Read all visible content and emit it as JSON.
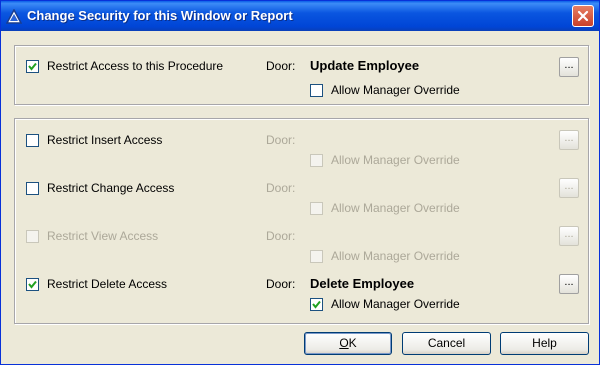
{
  "window": {
    "title": "Change Security for this Window or Report"
  },
  "procedure": {
    "restrict_label": "Restrict Access to this Procedure",
    "restrict_checked": true,
    "door_label": "Door:",
    "door_value": "Update Employee",
    "ellipsis": "...",
    "override_label": "Allow Manager Override",
    "override_checked": false
  },
  "access_rows": [
    {
      "restrict_label": "Restrict Insert Access",
      "restrict_checked": false,
      "restrict_enabled": true,
      "door_label": "Door:",
      "door_value": "",
      "ellipsis": "...",
      "override_label": "Allow Manager Override",
      "override_checked": false,
      "override_enabled": false
    },
    {
      "restrict_label": "Restrict Change Access",
      "restrict_checked": false,
      "restrict_enabled": true,
      "door_label": "Door:",
      "door_value": "",
      "ellipsis": "...",
      "override_label": "Allow Manager Override",
      "override_checked": false,
      "override_enabled": false
    },
    {
      "restrict_label": "Restrict View Access",
      "restrict_checked": false,
      "restrict_enabled": false,
      "door_label": "Door:",
      "door_value": "",
      "ellipsis": "...",
      "override_label": "Allow Manager Override",
      "override_checked": false,
      "override_enabled": false
    },
    {
      "restrict_label": "Restrict Delete Access",
      "restrict_checked": true,
      "restrict_enabled": true,
      "door_label": "Door:",
      "door_value": "Delete Employee",
      "ellipsis": "...",
      "override_label": "Allow Manager Override",
      "override_checked": true,
      "override_enabled": true
    }
  ],
  "buttons": {
    "ok": "OK",
    "cancel": "Cancel",
    "help": "Help"
  },
  "colors": {
    "titlebar": "#0054e3",
    "dialog_bg": "#ece9d8",
    "disabled_text": "#aca899",
    "close_button": "#d8593c"
  },
  "icons": {
    "title": "app-triangle-icon",
    "close": "close-icon",
    "check": "checkmark-icon"
  }
}
